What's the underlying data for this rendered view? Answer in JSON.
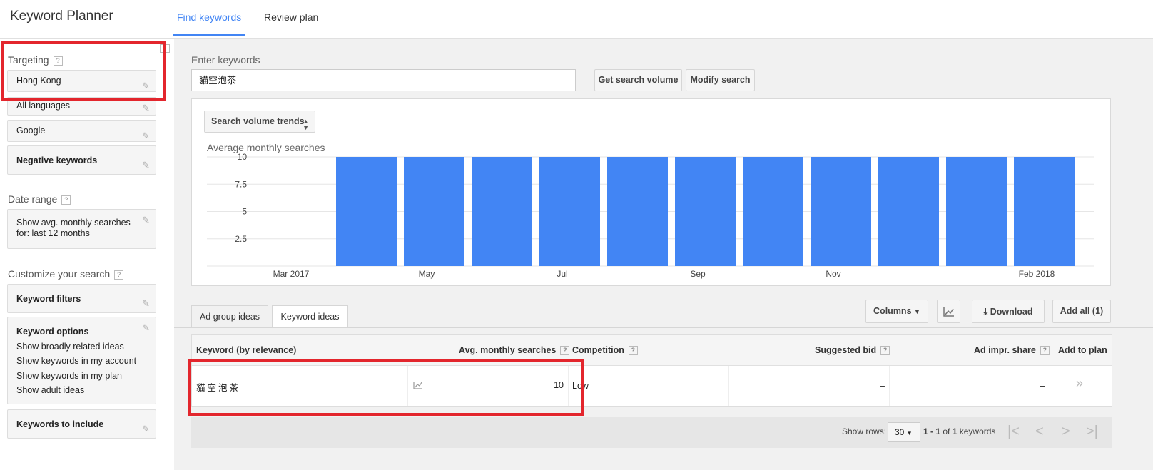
{
  "header": {
    "app_title": "Keyword Planner",
    "tabs": [
      {
        "label": "Find keywords",
        "active": true
      },
      {
        "label": "Review plan",
        "active": false
      }
    ]
  },
  "sidebar": {
    "targeting_label": "Targeting",
    "targeting_items": [
      "Hong Kong",
      "All languages",
      "Google"
    ],
    "negative_keywords": "Negative keywords",
    "date_range_label": "Date range",
    "date_range_line1": "Show avg. monthly searches",
    "date_range_line2": "for: last 12 months",
    "customize_label": "Customize your search",
    "keyword_filters": "Keyword filters",
    "keyword_options": {
      "title": "Keyword options",
      "lines": [
        "Show broadly related ideas",
        "Show keywords in my account",
        "Show keywords in my plan",
        "Show adult ideas"
      ]
    },
    "keywords_to_include": "Keywords to include",
    "help_mark": "?"
  },
  "search": {
    "label": "Enter keywords",
    "value": "貓空泡茶",
    "get_volume_button": "Get search volume",
    "modify_button": "Modify search"
  },
  "chart": {
    "dropdown_label": "Search volume trends"
  },
  "chart_data": {
    "type": "bar",
    "title": "Average monthly searches",
    "categories": [
      "Mar 2017",
      "Apr 2017",
      "May 2017",
      "Jun 2017",
      "Jul 2017",
      "Aug 2017",
      "Sep 2017",
      "Oct 2017",
      "Nov 2017",
      "Dec 2017",
      "Jan 2018",
      "Feb 2018"
    ],
    "values": [
      null,
      10,
      10,
      10,
      10,
      10,
      10,
      10,
      10,
      10,
      10,
      10
    ],
    "x_tick_labels": [
      "Mar 2017",
      "May",
      "Jul",
      "Sep",
      "Nov",
      "Feb 2018"
    ],
    "y_ticks": [
      "2.5",
      "5",
      "7.5",
      "10"
    ],
    "ylim": [
      0,
      10
    ],
    "grid": true,
    "color": "#4285f4"
  },
  "results": {
    "tabs": [
      {
        "label": "Ad group ideas",
        "active": false
      },
      {
        "label": "Keyword ideas",
        "active": true
      }
    ],
    "toolbar": {
      "columns": "Columns",
      "download": "Download",
      "add_all": "Add all (1)"
    },
    "columns": {
      "keyword": "Keyword (by relevance)",
      "avg_searches": "Avg. monthly searches",
      "competition": "Competition",
      "suggested_bid": "Suggested bid",
      "ad_share": "Ad impr. share",
      "add_to_plan": "Add to plan"
    },
    "rows": [
      {
        "keyword": "貓空泡茶",
        "avg_searches": "10",
        "competition": "Low",
        "suggested_bid": "–",
        "ad_share": "–",
        "add": "»"
      }
    ],
    "footer": {
      "show_rows_label": "Show rows:",
      "rows_value": "30",
      "range_a": "1 - 1",
      "of_word": "of",
      "total": "1",
      "unit": "keywords"
    }
  }
}
